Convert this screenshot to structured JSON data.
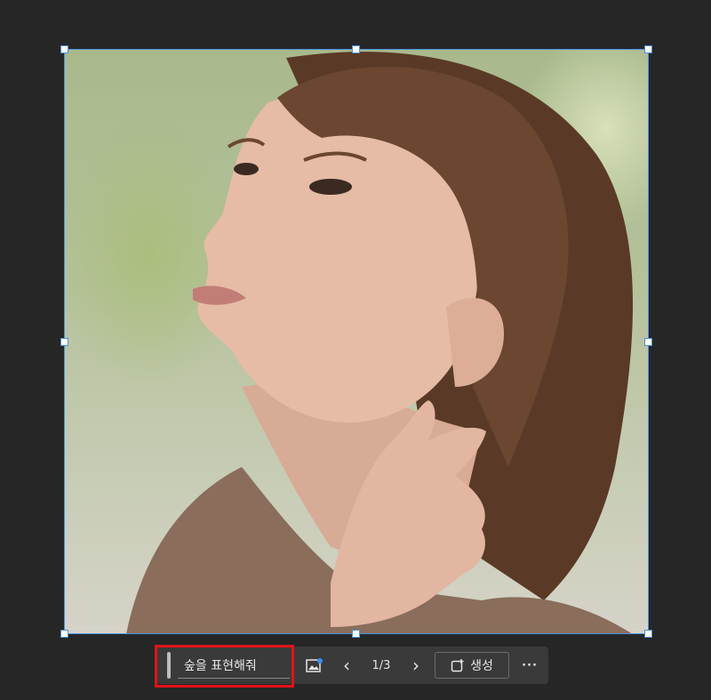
{
  "canvas": {
    "image_description_icon": "portrait-photo"
  },
  "toolbar": {
    "prompt_value": "숲을 표현해줘",
    "page_indicator": "1/3",
    "generate_label": "생성",
    "more_label": "···",
    "prev_label": "‹",
    "next_label": "›"
  },
  "icons": {
    "image_variation": "image-variation-icon",
    "generate": "generate-icon",
    "more": "more-options-icon"
  },
  "colors": {
    "background": "#262626",
    "selection": "#4a90e2",
    "highlight": "#e0131b",
    "toolbar": "#3a3a3a"
  }
}
